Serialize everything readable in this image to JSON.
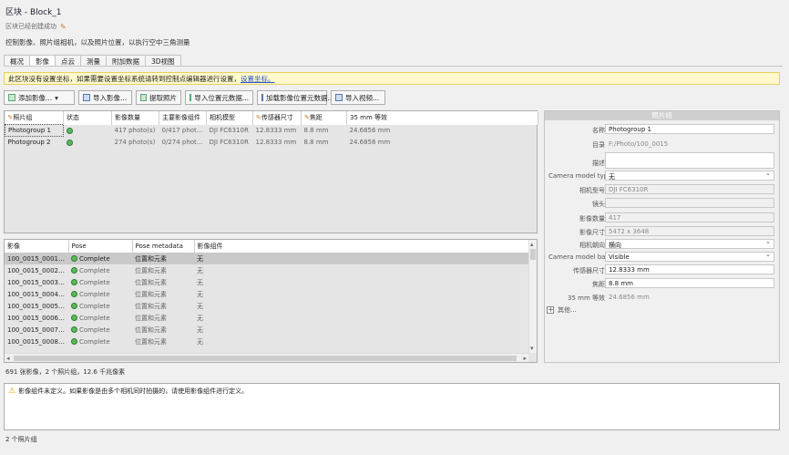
{
  "header": {
    "title": "区块 - Block_1",
    "subtitle": "区块已经创建成功",
    "description": "控制影像、照片组相机，以及照片位置，以执行空中三角测量"
  },
  "tabs": [
    "概况",
    "影像",
    "点云",
    "测量",
    "附加数据",
    "3D视图"
  ],
  "info_bar": {
    "text": "此区块没有设置坐标，如果需要设置坐标系统请转到控制点编辑器进行设置，",
    "link": "设置坐标。"
  },
  "toolbar": {
    "add_images": "添加影像...",
    "import_images": "导入影像...",
    "extract_photos": "提取照片",
    "import_positions": "导入位置元数据...",
    "load_metadata": "加载影像位置元数据...",
    "import_video": "导入视频..."
  },
  "photogroups": {
    "columns": [
      "照片组",
      "状态",
      "影像数量",
      "主要影像组件",
      "相机模型",
      "传感器尺寸",
      "焦距",
      "35 mm 等效"
    ],
    "rows": [
      [
        "Photogroup 1",
        "",
        "417 photo(s)",
        "0/417 photo(s)",
        "DJI FC6310R",
        "12.8333 mm",
        "8.8 mm",
        "24.6856 mm"
      ],
      [
        "Photogroup 2",
        "",
        "274 photo(s)",
        "0/274 photo(s)",
        "DJI FC6310R",
        "12.8333 mm",
        "8.8 mm",
        "24.6856 mm"
      ]
    ]
  },
  "photos": {
    "columns": [
      "影像",
      "Pose",
      "Pose metadata",
      "影像组件"
    ],
    "rows": [
      [
        "100_0015_0001.JPG",
        "Complete",
        "位置和元素",
        "无"
      ],
      [
        "100_0015_0002.JPG",
        "Complete",
        "位置和元素",
        "无"
      ],
      [
        "100_0015_0003.JPG",
        "Complete",
        "位置和元素",
        "无"
      ],
      [
        "100_0015_0004.JPG",
        "Complete",
        "位置和元素",
        "无"
      ],
      [
        "100_0015_0005.JPG",
        "Complete",
        "位置和元素",
        "无"
      ],
      [
        "100_0015_0006.JPG",
        "Complete",
        "位置和元素",
        "无"
      ],
      [
        "100_0015_0007.JPG",
        "Complete",
        "位置和元素",
        "无"
      ],
      [
        "100_0015_0008.JPG",
        "Complete",
        "位置和元素",
        "无"
      ]
    ]
  },
  "properties": {
    "header": "照片组",
    "rows": [
      {
        "label": "名称",
        "value": "Photogroup 1",
        "kind": "edit"
      },
      {
        "label": "目录",
        "value": "F:/Photo/100_0015",
        "kind": "ro"
      },
      {
        "label": "描述",
        "value": "",
        "kind": "edit"
      },
      {
        "label": "Camera model type",
        "value": "无",
        "kind": "select"
      },
      {
        "label": "相机型号",
        "value": "DJI FC6310R",
        "kind": "ro"
      },
      {
        "label": "镜头",
        "value": "",
        "kind": "ro"
      },
      {
        "label": "影像数量",
        "value": "417",
        "kind": "ro"
      },
      {
        "label": "影像尺寸",
        "value": "5472 x 3648",
        "kind": "ro"
      },
      {
        "label": "相机朝向",
        "value": "横向",
        "kind": "select"
      },
      {
        "label": "Camera model band",
        "value": "Visible",
        "kind": "select"
      },
      {
        "label": "传感器尺寸",
        "value": "12.8333 mm",
        "kind": "edit"
      },
      {
        "label": "焦距",
        "value": "8.8 mm",
        "kind": "edit"
      },
      {
        "label": "35 mm 等效",
        "value": "24.6856 mm",
        "kind": "plain"
      }
    ],
    "more": "其他..."
  },
  "status_line": "691 张影像，2 个照片组，12.6 千兆像素",
  "warning": "影像组件未定义。如果影像是由多个相机同时拍摄的，请使用影像组件进行定义。",
  "status_footer": "2 个照片组"
}
